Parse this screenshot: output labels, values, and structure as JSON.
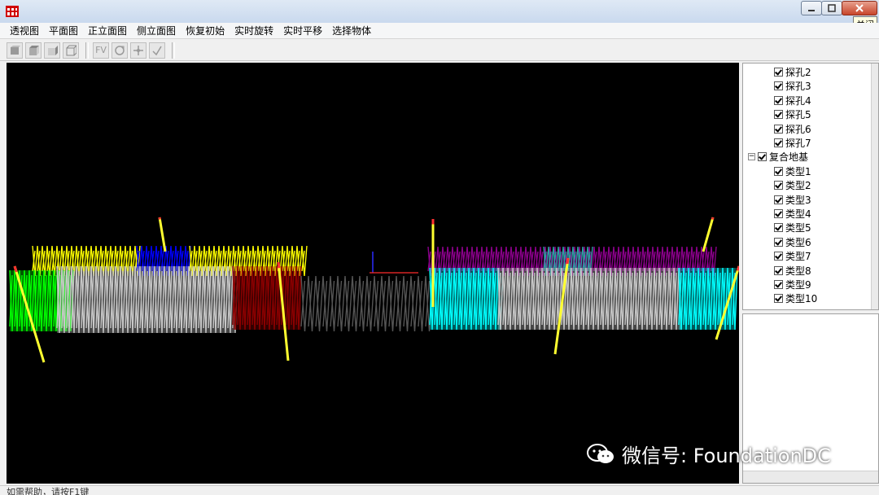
{
  "window": {
    "tooltip": "关闭"
  },
  "menu": [
    "透视图",
    "平面图",
    "正立面图",
    "侧立面图",
    "恢复初始",
    "实时旋转",
    "实时平移",
    "选择物体"
  ],
  "toolbar": {
    "fv_label": "FV"
  },
  "tree": {
    "holes": [
      "探孔2",
      "探孔3",
      "探孔4",
      "探孔5",
      "探孔6",
      "探孔7"
    ],
    "group_label": "复合地基",
    "types": [
      "类型1",
      "类型2",
      "类型3",
      "类型4",
      "类型5",
      "类型6",
      "类型7",
      "类型8",
      "类型9",
      "类型10"
    ]
  },
  "status": {
    "text": "如需帮助，请按F1键"
  },
  "watermark": {
    "text": "微信号: FoundationDC"
  },
  "colors": {
    "yellow": "#ffff00",
    "blue": "#0000ff",
    "green": "#00ff00",
    "gray": "#c8c8c8",
    "red": "#8b0000",
    "magenta": "#8b008b",
    "cyan": "#00ffff",
    "teal": "#2aa1a1",
    "dark": "#555555"
  }
}
